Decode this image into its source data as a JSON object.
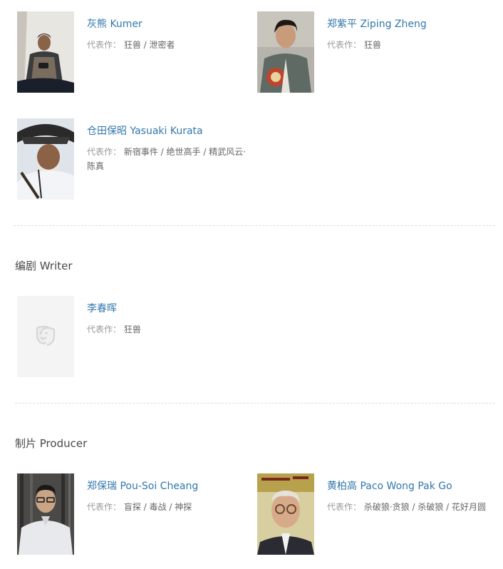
{
  "actors": [
    {
      "name": "灰熊 Kumer",
      "works_label": "代表作：",
      "works": "狂兽 / 泄密者"
    },
    {
      "name": "郑紫平 Ziping Zheng",
      "works_label": "代表作：",
      "works": "狂兽"
    },
    {
      "name": "仓田保昭 Yasuaki Kurata",
      "works_label": "代表作：",
      "works": "新宿事件 / 绝世高手 / 精武风云·陈真"
    }
  ],
  "writer_section": {
    "title": "编剧 Writer",
    "people": [
      {
        "name": "李春晖",
        "works_label": "代表作：",
        "works": "狂兽",
        "photo_icon": "theater-masks-icon"
      }
    ]
  },
  "producer_section": {
    "title": "制片 Producer",
    "people": [
      {
        "name": "郑保瑞 Pou-Soi Cheang",
        "works_label": "代表作：",
        "works": "盲探 / 毒战 / 神探"
      },
      {
        "name": "黄柏高 Paco Wong Pak Go",
        "works_label": "代表作：",
        "works": "杀破狼·贪狼 / 杀破狼 / 花好月圆"
      }
    ]
  },
  "colors": {
    "link": "#3377aa",
    "muted_text": "#999999",
    "divider": "#dddddd",
    "placeholder_bg": "#f4f4f4"
  }
}
